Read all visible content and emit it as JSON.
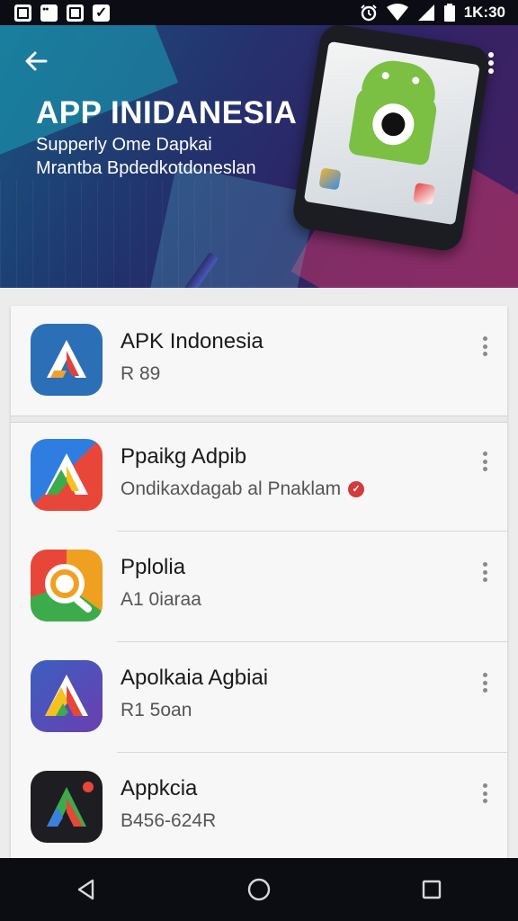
{
  "status_bar": {
    "time": "1K:30",
    "left_icons": [
      "image-icon",
      "gallery-icon",
      "notification-icon",
      "check-icon"
    ],
    "right_icons": [
      "alarm-icon",
      "wifi-icon",
      "signal-icon",
      "battery-icon"
    ]
  },
  "banner": {
    "title": "APP INIDANESIA",
    "subtitle_line1": "Supperly Ome Dapkai",
    "subtitle_line2": "Mrantba Bpdedkotdoneslan",
    "back_icon": "arrow-back-icon",
    "menu_icon": "more-vert-icon",
    "colors": {
      "bg_start": "#0f4b78",
      "bg_end": "#442062",
      "accent_pink": "#e23a68",
      "accent_teal": "#1aa3b8",
      "android_green": "#7bc043"
    }
  },
  "apps": [
    {
      "name": "APK Indonesia",
      "subtitle": "R 89",
      "icon": "apk-indonesia-icon",
      "badge": ""
    },
    {
      "name": "Ppaikg Adpib",
      "subtitle": "Ondikaxdagab al Pnaklam",
      "icon": "ppaikg-adpib-icon",
      "badge": "✓"
    },
    {
      "name": "Pplolia",
      "subtitle": "A1 0iaraa",
      "icon": "pplolia-icon",
      "badge": ""
    },
    {
      "name": "Apolkaia Agbiai",
      "subtitle": "R1 5oan",
      "icon": "apolkaia-agbiai-icon",
      "badge": ""
    },
    {
      "name": "Appkcia",
      "subtitle": "B456-624R",
      "icon": "appkcia-icon",
      "badge": ""
    }
  ],
  "nav_bar": {
    "back": "nav-back-icon",
    "home": "nav-home-icon",
    "recents": "nav-recents-icon"
  }
}
